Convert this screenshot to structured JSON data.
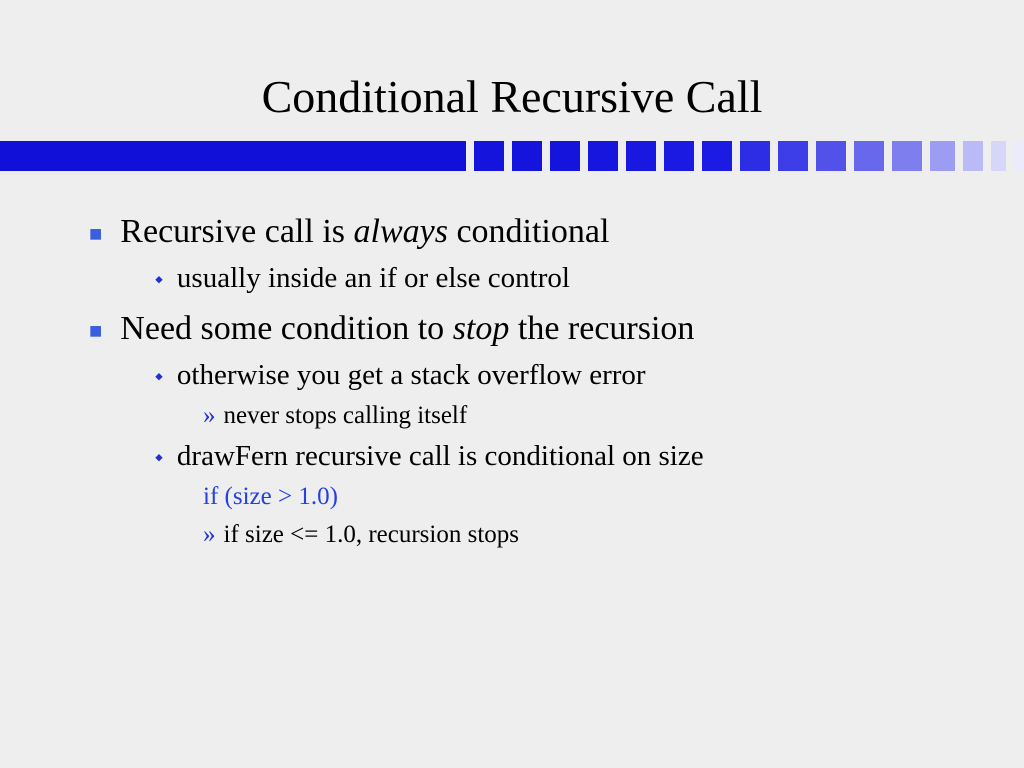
{
  "title": "Conditional Recursive Call",
  "stripe_colors": [
    "#1414dc",
    "#1414dc",
    "#1414dc",
    "#1616de",
    "#1818e0",
    "#1a1ae2",
    "#1b1be4",
    "#2d2de6",
    "#3e3ee8",
    "#5252ea",
    "#6868ec",
    "#7e7eee",
    "#9c9cf2",
    "#babaf6",
    "#d6d6f9",
    "#ebebfb"
  ],
  "b1": {
    "pre": "Recursive call is ",
    "em": "always",
    "post": " conditional"
  },
  "b1_1": "usually inside an if or else control",
  "b2": {
    "pre": "Need some condition to ",
    "em": "stop",
    "post": " the recursion"
  },
  "b2_1": "otherwise you get a stack overflow error",
  "b2_1_1": "never stops calling itself",
  "b2_2": "drawFern recursive call is conditional on size",
  "b2_2_code": "if (size > 1.0)",
  "b2_2_1": "if size <= 1.0, recursion stops"
}
